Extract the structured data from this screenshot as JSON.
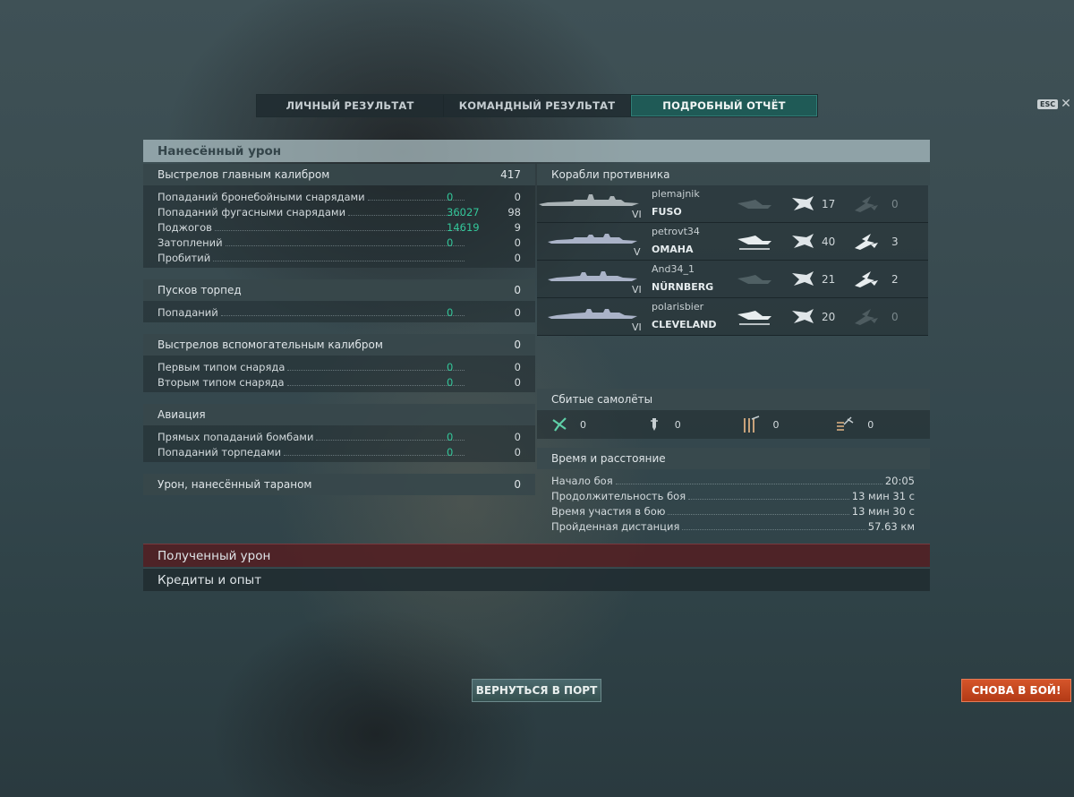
{
  "tabs": [
    "ЛИЧНЫЙ РЕЗУЛЬТАТ",
    "КОМАНДНЫЙ РЕЗУЛЬТАТ",
    "ПОДРОБНЫЙ ОТЧЁТ"
  ],
  "active_tab": "ПОДРОБНЫЙ ОТЧЁТ",
  "esc": {
    "key": "ESC",
    "close": "✕"
  },
  "damage": {
    "title": "Нанесённый урон",
    "main_battery": {
      "label": "Выстрелов главным калибром",
      "value": "417",
      "rows": [
        {
          "label": "Попаданий бронебойными снарядами",
          "a": "0",
          "b": "0"
        },
        {
          "label": "Попаданий фугасными снарядами",
          "a": "36027",
          "b": "98"
        },
        {
          "label": "Поджогов",
          "a": "14619",
          "b": "9"
        },
        {
          "label": "Затоплений",
          "a": "0",
          "b": "0"
        },
        {
          "label": "Пробитий",
          "a": "",
          "b": "0"
        }
      ]
    },
    "torpedoes": {
      "label": "Пусков торпед",
      "value": "0",
      "rows": [
        {
          "label": "Попаданий",
          "a": "0",
          "b": "0"
        }
      ]
    },
    "secondary": {
      "label": "Выстрелов вспомогательным калибром",
      "value": "0",
      "rows": [
        {
          "label": "Первым типом снаряда",
          "a": "0",
          "b": "0"
        },
        {
          "label": "Вторым типом снаряда",
          "a": "0",
          "b": "0"
        }
      ]
    },
    "aviation": {
      "label": "Авиация",
      "value": "",
      "rows": [
        {
          "label": "Прямых попаданий бомбами",
          "a": "0",
          "b": "0"
        },
        {
          "label": "Попаданий торпедами",
          "a": "0",
          "b": "0"
        }
      ]
    },
    "ram": {
      "label": "Урон, нанесённый тараном",
      "value": "0"
    }
  },
  "enemies": {
    "title": "Корабли противника",
    "ships": [
      {
        "player": "plemajnik",
        "ship": "FUSO",
        "tier": "VI",
        "destroyed": false,
        "hits": "17",
        "fires": "0",
        "fires_active": false
      },
      {
        "player": "petrovt34",
        "ship": "OMAHA",
        "tier": "V",
        "destroyed": true,
        "hits": "40",
        "fires": "3",
        "fires_active": true
      },
      {
        "player": "And34_1",
        "ship": "NÜRNBERG",
        "tier": "VI",
        "destroyed": false,
        "hits": "21",
        "fires": "2",
        "fires_active": true
      },
      {
        "player": "polarisbier",
        "ship": "CLEVELAND",
        "tier": "VI",
        "destroyed": true,
        "hits": "20",
        "fires": "0",
        "fires_active": false
      }
    ]
  },
  "planes": {
    "title": "Сбитые самолёты",
    "items": [
      {
        "icon": "fighter-icon",
        "value": "0"
      },
      {
        "icon": "bomber-icon",
        "value": "0"
      },
      {
        "icon": "torpedo-bomber-icon",
        "value": "0"
      },
      {
        "icon": "scout-plane-icon",
        "value": "0"
      }
    ]
  },
  "time": {
    "title": "Время и расстояние",
    "rows": [
      {
        "label": "Начало боя",
        "value": "20:05"
      },
      {
        "label": "Продолжительность боя",
        "value": "13 мин 31 с"
      },
      {
        "label": "Время участия в бою",
        "value": "13 мин 30 с"
      },
      {
        "label": "Пройденная дистанция",
        "value": "57.63 км"
      }
    ]
  },
  "received": {
    "label": "Полученный урон"
  },
  "credits": {
    "label": "Кредиты и опыт"
  },
  "buttons": {
    "port": "ВЕРНУТЬСЯ В ПОРТ",
    "battle": "СНОВА В БОЙ!"
  },
  "colors": {
    "accent_green": "#33c79a",
    "tab_active": "#1f5a56",
    "battle_button": "#c8461f",
    "received_bar": "#5a2328"
  }
}
